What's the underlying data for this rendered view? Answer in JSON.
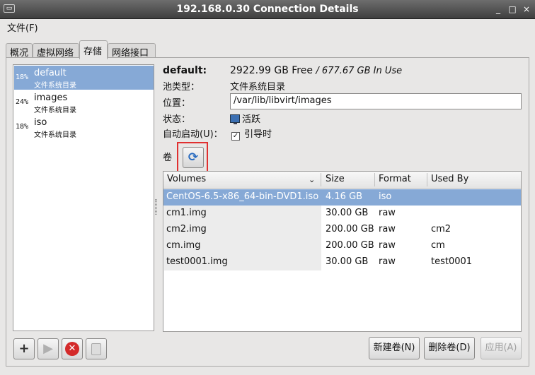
{
  "window": {
    "title": "192.168.0.30 Connection Details"
  },
  "menubar": {
    "file_label": "文件(F)"
  },
  "tabs": [
    {
      "label": "概况"
    },
    {
      "label": "虚拟网络"
    },
    {
      "label": "存储"
    },
    {
      "label": "网络接口"
    }
  ],
  "pools": [
    {
      "percent": "18%",
      "name": "default",
      "type": "文件系统目录"
    },
    {
      "percent": "24%",
      "name": "images",
      "type": "文件系统目录"
    },
    {
      "percent": "18%",
      "name": "iso",
      "type": "文件系统目录"
    }
  ],
  "details": {
    "pool_name": "default:",
    "free": "2922.99 GB Free",
    "in_use": "/ 677.67 GB In Use",
    "pool_type_label": "池类型：",
    "pool_type_value": "文件系统目录",
    "location_label": "位置：",
    "location_value": "/var/lib/libvirt/images",
    "state_label": "状态：",
    "state_value": "活跃",
    "autostart_label": "自动启动(U)：",
    "autostart_value": "引导时",
    "volumes_label": "卷"
  },
  "volumes": {
    "headers": [
      "Volumes",
      "Size",
      "Format",
      "Used By"
    ],
    "rows": [
      {
        "name": "CentOS-6.5-x86_64-bin-DVD1.iso",
        "size": "4.16 GB",
        "format": "iso",
        "used_by": ""
      },
      {
        "name": "cm1.img",
        "size": "30.00 GB",
        "format": "raw",
        "used_by": ""
      },
      {
        "name": "cm2.img",
        "size": "200.00 GB",
        "format": "raw",
        "used_by": "cm2"
      },
      {
        "name": "cm.img",
        "size": "200.00 GB",
        "format": "raw",
        "used_by": "cm"
      },
      {
        "name": "test0001.img",
        "size": "30.00 GB",
        "format": "raw",
        "used_by": "test0001"
      }
    ]
  },
  "buttons": {
    "new_volume": "新建卷(N)",
    "delete_volume": "删除卷(D)",
    "apply": "应用(A)"
  }
}
